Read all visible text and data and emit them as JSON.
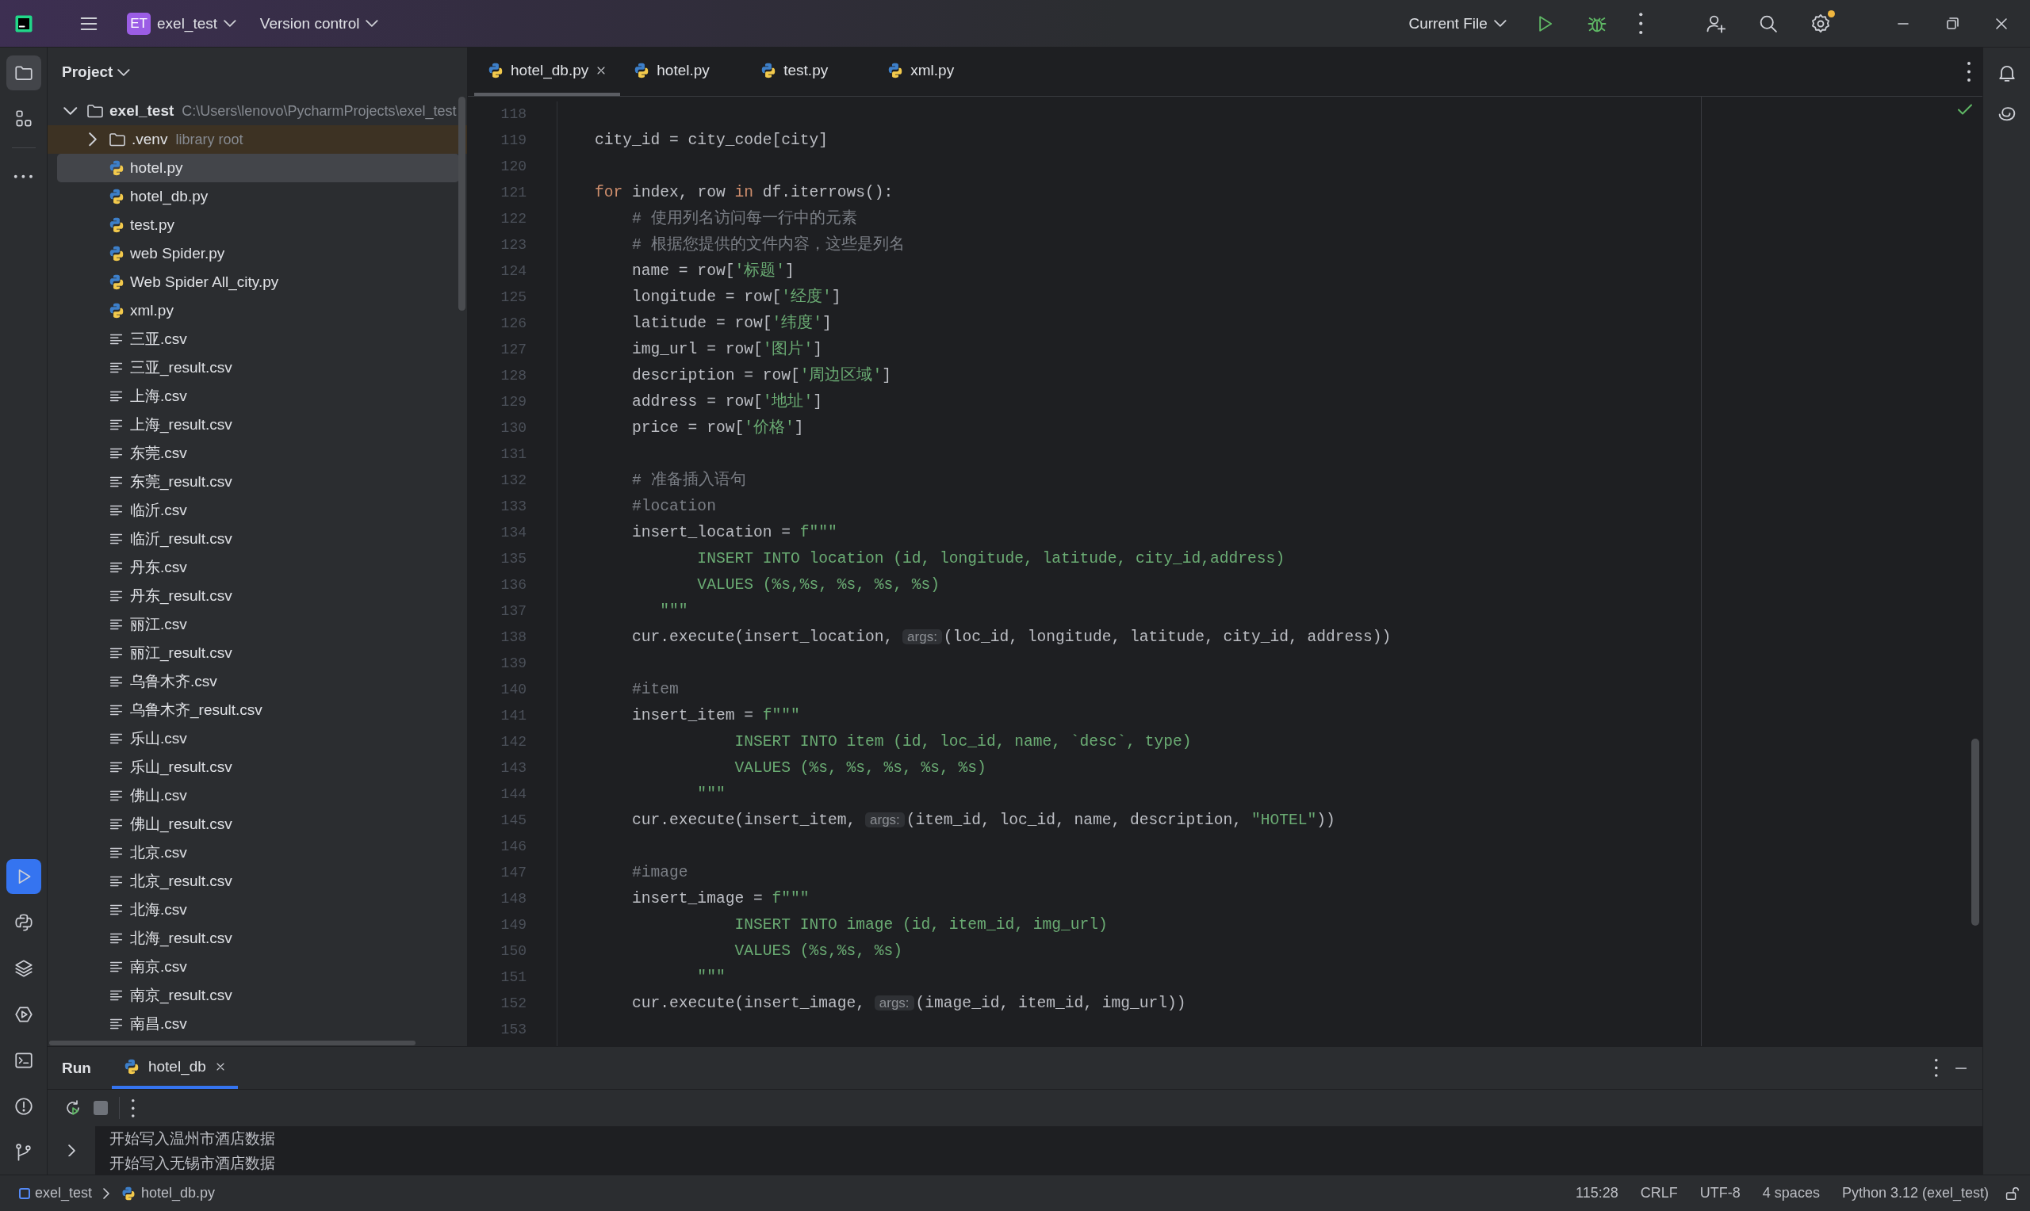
{
  "title_bar": {
    "project_badge": "ET",
    "project_name": "exel_test",
    "vcs": "Version control",
    "run_config": "Current File",
    "settings_badge": true
  },
  "left_toolbar": {
    "top": [
      {
        "kind": "project",
        "selected": true
      },
      {
        "kind": "structure",
        "selected": false
      },
      {
        "kind": "more",
        "selected": false
      }
    ],
    "bottom": [
      {
        "kind": "run",
        "selected": true
      },
      {
        "kind": "python-console",
        "selected": false
      },
      {
        "kind": "layers",
        "selected": false
      },
      {
        "kind": "services",
        "selected": false
      },
      {
        "kind": "terminal",
        "selected": false
      },
      {
        "kind": "problems",
        "selected": false
      },
      {
        "kind": "git",
        "selected": false
      }
    ]
  },
  "project": {
    "title": "Project",
    "tree": [
      {
        "kind": "folder",
        "label": "exel_test",
        "hint": "C:\\Users\\lenovo\\PycharmProjects\\exel_test",
        "expanded": true,
        "selected": false,
        "children": [
          {
            "kind": "library",
            "label": ".venv",
            "hint": "library root",
            "expanded": false,
            "selected": false
          },
          {
            "kind": "python",
            "label": "hotel.py",
            "selected": true
          },
          {
            "kind": "python",
            "label": "hotel_db.py",
            "selected": false
          },
          {
            "kind": "python",
            "label": "test.py",
            "selected": false
          },
          {
            "kind": "python",
            "label": "web Spider.py",
            "selected": false
          },
          {
            "kind": "python",
            "label": "Web Spider All_city.py",
            "selected": false
          },
          {
            "kind": "python",
            "label": "xml.py",
            "selected": false
          },
          {
            "kind": "text",
            "label": "三亚.csv",
            "selected": false
          },
          {
            "kind": "text",
            "label": "三亚_result.csv",
            "selected": false
          },
          {
            "kind": "text",
            "label": "上海.csv",
            "selected": false
          },
          {
            "kind": "text",
            "label": "上海_result.csv",
            "selected": false
          },
          {
            "kind": "text",
            "label": "东莞.csv",
            "selected": false
          },
          {
            "kind": "text",
            "label": "东莞_result.csv",
            "selected": false
          },
          {
            "kind": "text",
            "label": "临沂.csv",
            "selected": false
          },
          {
            "kind": "text",
            "label": "临沂_result.csv",
            "selected": false
          },
          {
            "kind": "text",
            "label": "丹东.csv",
            "selected": false
          },
          {
            "kind": "text",
            "label": "丹东_result.csv",
            "selected": false
          },
          {
            "kind": "text",
            "label": "丽江.csv",
            "selected": false
          },
          {
            "kind": "text",
            "label": "丽江_result.csv",
            "selected": false
          },
          {
            "kind": "text",
            "label": "乌鲁木齐.csv",
            "selected": false
          },
          {
            "kind": "text",
            "label": "乌鲁木齐_result.csv",
            "selected": false
          },
          {
            "kind": "text",
            "label": "乐山.csv",
            "selected": false
          },
          {
            "kind": "text",
            "label": "乐山_result.csv",
            "selected": false
          },
          {
            "kind": "text",
            "label": "佛山.csv",
            "selected": false
          },
          {
            "kind": "text",
            "label": "佛山_result.csv",
            "selected": false
          },
          {
            "kind": "text",
            "label": "北京.csv",
            "selected": false
          },
          {
            "kind": "text",
            "label": "北京_result.csv",
            "selected": false
          },
          {
            "kind": "text",
            "label": "北海.csv",
            "selected": false
          },
          {
            "kind": "text",
            "label": "北海_result.csv",
            "selected": false
          },
          {
            "kind": "text",
            "label": "南京.csv",
            "selected": false
          },
          {
            "kind": "text",
            "label": "南京_result.csv",
            "selected": false
          },
          {
            "kind": "text",
            "label": "南昌.csv",
            "selected": false
          }
        ]
      }
    ]
  },
  "tabs": [
    {
      "label": "hotel_db.py",
      "selected": true
    },
    {
      "label": "hotel.py",
      "selected": false
    },
    {
      "label": "test.py",
      "selected": false
    },
    {
      "label": "xml.py",
      "selected": false
    }
  ],
  "code": [
    {
      "number": "118"
    },
    {
      "number": "119",
      "tokens": [
        {
          "kind": "plain",
          "text": "    city_id = city_code[city]"
        }
      ]
    },
    {
      "number": "120"
    },
    {
      "number": "121",
      "tokens": [
        {
          "kind": "keyword",
          "text": "    for"
        },
        {
          "kind": "plain",
          "text": " index, row "
        },
        {
          "kind": "keyword",
          "text": "in"
        },
        {
          "kind": "plain",
          "text": " df.iterrows():"
        }
      ]
    },
    {
      "number": "122",
      "tokens": [
        {
          "kind": "comment",
          "text": "        # 使用列名访问每一行中的元素"
        }
      ]
    },
    {
      "number": "123",
      "tokens": [
        {
          "kind": "comment",
          "text": "        # 根据您提供的文件内容，这些是列名"
        }
      ]
    },
    {
      "number": "124",
      "tokens": [
        {
          "kind": "plain",
          "text": "        name = row["
        },
        {
          "kind": "string",
          "text": "'标题'"
        },
        {
          "kind": "plain",
          "text": "]"
        }
      ]
    },
    {
      "number": "125",
      "tokens": [
        {
          "kind": "plain",
          "text": "        longitude = row["
        },
        {
          "kind": "string",
          "text": "'经度'"
        },
        {
          "kind": "plain",
          "text": "]"
        }
      ]
    },
    {
      "number": "126",
      "tokens": [
        {
          "kind": "plain",
          "text": "        latitude = row["
        },
        {
          "kind": "string",
          "text": "'纬度'"
        },
        {
          "kind": "plain",
          "text": "]"
        }
      ]
    },
    {
      "number": "127",
      "tokens": [
        {
          "kind": "plain",
          "text": "        img_url = row["
        },
        {
          "kind": "string",
          "text": "'图片'"
        },
        {
          "kind": "plain",
          "text": "]"
        }
      ]
    },
    {
      "number": "128",
      "tokens": [
        {
          "kind": "plain",
          "text": "        description = row["
        },
        {
          "kind": "string",
          "text": "'周边区域'"
        },
        {
          "kind": "plain",
          "text": "]"
        }
      ]
    },
    {
      "number": "129",
      "tokens": [
        {
          "kind": "plain",
          "text": "        address = row["
        },
        {
          "kind": "string",
          "text": "'地址'"
        },
        {
          "kind": "plain",
          "text": "]"
        }
      ]
    },
    {
      "number": "130",
      "tokens": [
        {
          "kind": "plain",
          "text": "        price = row["
        },
        {
          "kind": "string",
          "text": "'价格'"
        },
        {
          "kind": "plain",
          "text": "]"
        }
      ]
    },
    {
      "number": "131"
    },
    {
      "number": "132",
      "tokens": [
        {
          "kind": "comment",
          "text": "        # 准备插入语句"
        }
      ]
    },
    {
      "number": "133",
      "tokens": [
        {
          "kind": "comment",
          "text": "        #location"
        }
      ]
    },
    {
      "number": "134",
      "tokens": [
        {
          "kind": "plain",
          "text": "        insert_location = "
        },
        {
          "kind": "string",
          "text": "f\"\"\""
        }
      ]
    },
    {
      "number": "135",
      "tokens": [
        {
          "kind": "string",
          "text": "               INSERT INTO location (id, longitude, latitude, city_id,address)"
        }
      ]
    },
    {
      "number": "136",
      "tokens": [
        {
          "kind": "string",
          "text": "               VALUES (%s,%s, %s, %s, %s)"
        }
      ]
    },
    {
      "number": "137",
      "tokens": [
        {
          "kind": "string",
          "text": "           \"\"\""
        }
      ]
    },
    {
      "number": "138",
      "tokens": [
        {
          "kind": "plain",
          "text": "        cur.execute(insert_location, "
        },
        {
          "kind": "hint",
          "text": "args:"
        },
        {
          "kind": "plain",
          "text": "(loc_id, longitude, latitude, city_id, address))"
        }
      ]
    },
    {
      "number": "139"
    },
    {
      "number": "140",
      "tokens": [
        {
          "kind": "comment",
          "text": "        #item"
        }
      ]
    },
    {
      "number": "141",
      "tokens": [
        {
          "kind": "plain",
          "text": "        insert_item = "
        },
        {
          "kind": "string",
          "text": "f\"\"\""
        }
      ]
    },
    {
      "number": "142",
      "tokens": [
        {
          "kind": "string",
          "text": "                   INSERT INTO item (id, loc_id, name, `desc`, type)"
        }
      ]
    },
    {
      "number": "143",
      "tokens": [
        {
          "kind": "string",
          "text": "                   VALUES (%s, %s, %s, %s, %s)"
        }
      ]
    },
    {
      "number": "144",
      "tokens": [
        {
          "kind": "string",
          "text": "               \"\"\""
        }
      ]
    },
    {
      "number": "145",
      "tokens": [
        {
          "kind": "plain",
          "text": "        cur.execute(insert_item, "
        },
        {
          "kind": "hint",
          "text": "args:"
        },
        {
          "kind": "plain",
          "text": "(item_id, loc_id, name, description, "
        },
        {
          "kind": "string",
          "text": "\"HOTEL\""
        },
        {
          "kind": "plain",
          "text": "))"
        }
      ]
    },
    {
      "number": "146"
    },
    {
      "number": "147",
      "tokens": [
        {
          "kind": "comment",
          "text": "        #image"
        }
      ]
    },
    {
      "number": "148",
      "tokens": [
        {
          "kind": "plain",
          "text": "        insert_image = "
        },
        {
          "kind": "string",
          "text": "f\"\"\""
        }
      ]
    },
    {
      "number": "149",
      "tokens": [
        {
          "kind": "string",
          "text": "                   INSERT INTO image (id, item_id, img_url)"
        }
      ]
    },
    {
      "number": "150",
      "tokens": [
        {
          "kind": "string",
          "text": "                   VALUES (%s,%s, %s)"
        }
      ]
    },
    {
      "number": "151",
      "tokens": [
        {
          "kind": "string",
          "text": "               \"\"\""
        }
      ]
    },
    {
      "number": "152",
      "tokens": [
        {
          "kind": "plain",
          "text": "        cur.execute(insert_image, "
        },
        {
          "kind": "hint",
          "text": "args:"
        },
        {
          "kind": "plain",
          "text": "(image_id, item_id, img_url))"
        }
      ]
    },
    {
      "number": "153"
    }
  ],
  "run": {
    "title": "Run",
    "tabs": [
      {
        "label": "hotel_db",
        "selected": true
      }
    ],
    "output": [
      "开始写入温州市酒店数据",
      "开始写入无锡市酒店数据"
    ]
  },
  "status_bar": {
    "breadcrumbs": [
      {
        "kind": "project",
        "label": "exel_test"
      },
      {
        "kind": "python",
        "label": "hotel_db.py"
      }
    ],
    "items": [
      "115:28",
      "CRLF",
      "UTF-8",
      "4 spaces",
      "Python 3.12 (exel_test)"
    ]
  }
}
